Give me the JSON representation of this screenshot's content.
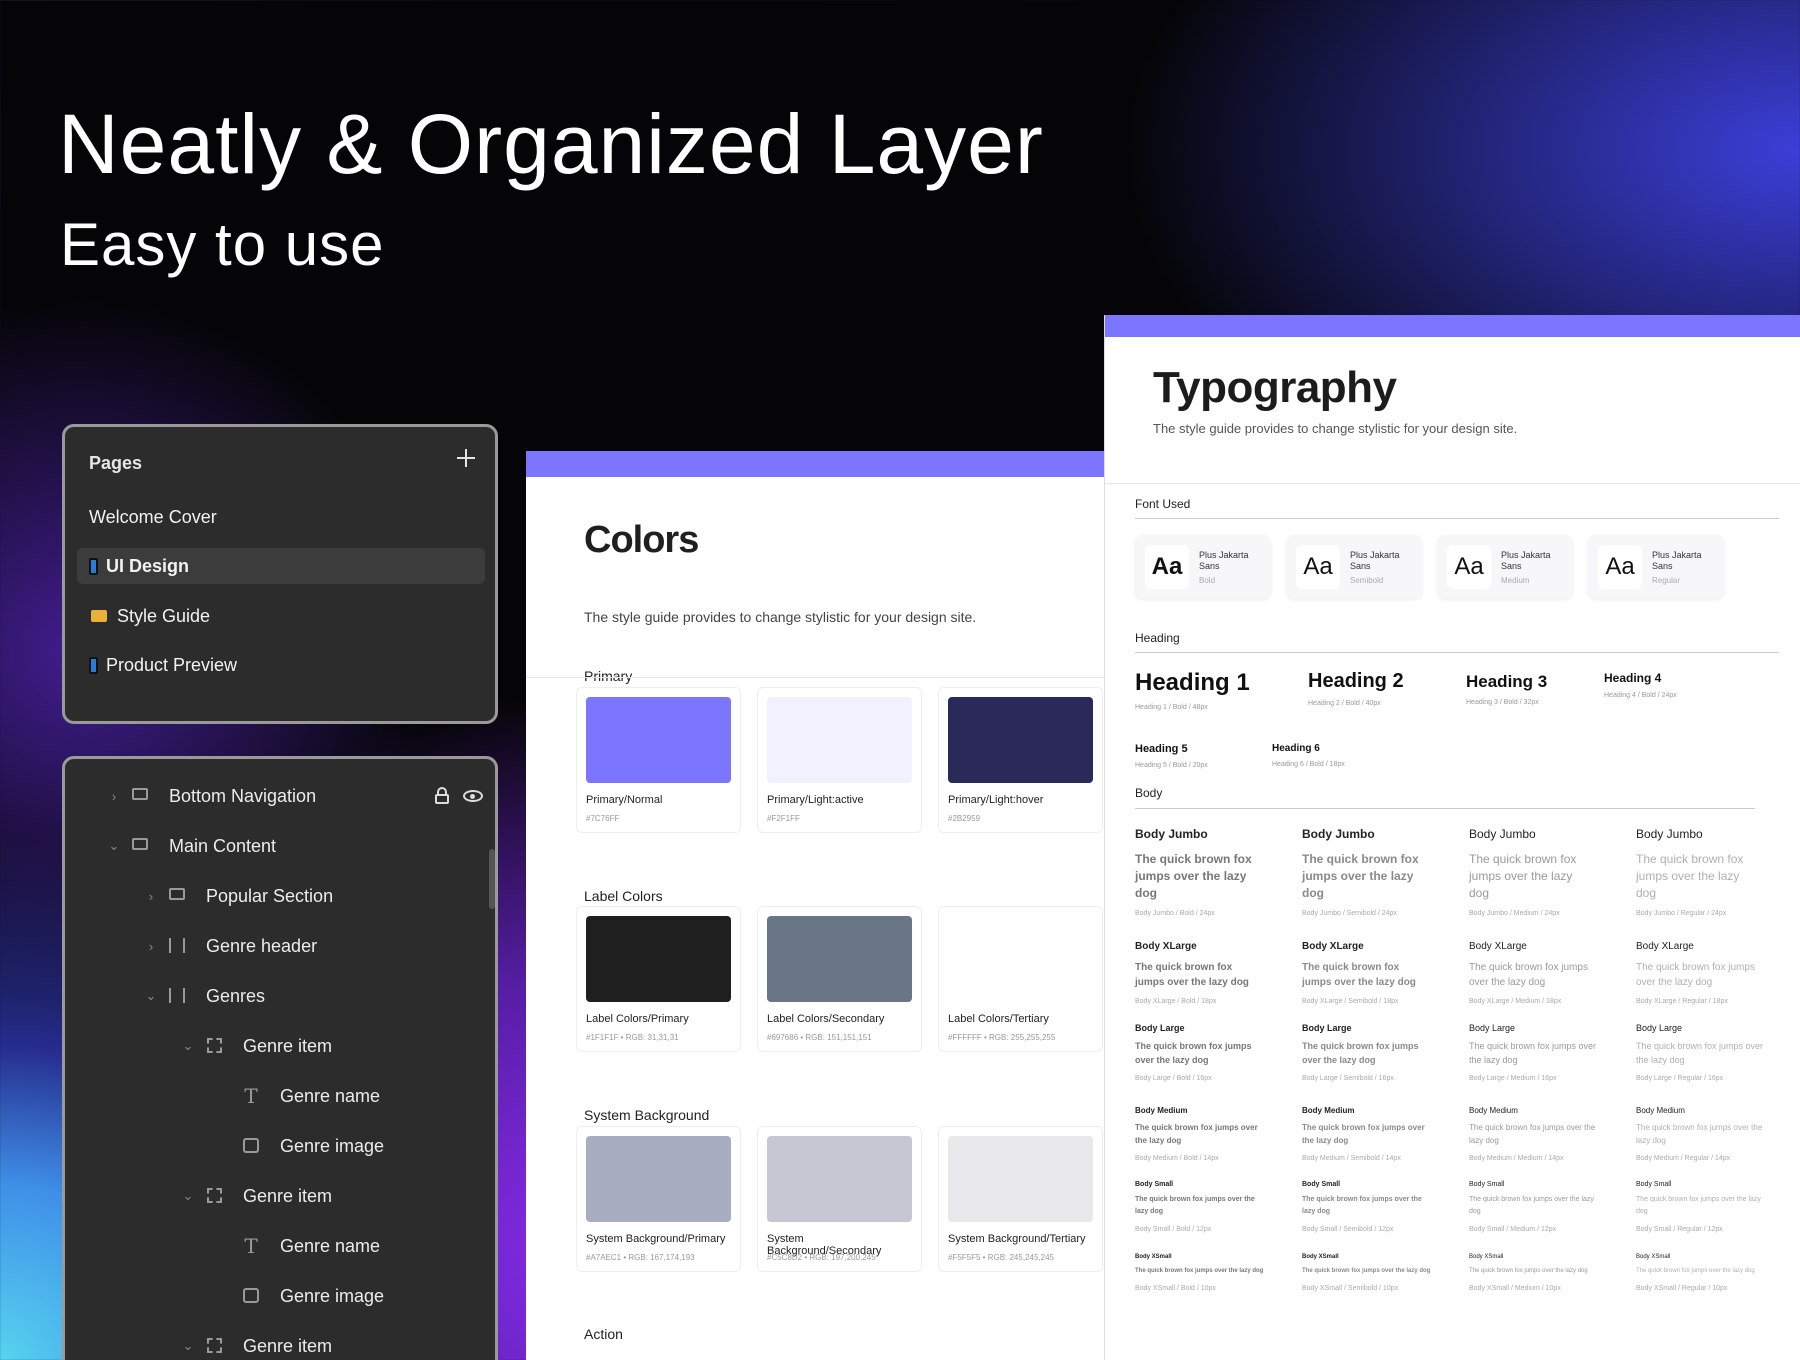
{
  "hero": {
    "title": "Neatly & Organized Layer",
    "subtitle": "Easy to use"
  },
  "pages_panel": {
    "title": "Pages",
    "items": [
      {
        "label": "Welcome Cover",
        "icon": "none"
      },
      {
        "label": "UI Design",
        "icon": "phone-icon"
      },
      {
        "label": "Style Guide",
        "icon": "folder-icon"
      },
      {
        "label": "Product Preview",
        "icon": "phone-icon"
      }
    ]
  },
  "layers_panel": {
    "items": [
      {
        "label": "Bottom Navigation",
        "icon": "frame-icon",
        "expanded": false
      },
      {
        "label": "Main Content",
        "icon": "frame-icon",
        "expanded": true
      },
      {
        "label": "Popular Section",
        "icon": "frame-icon",
        "expanded": false
      },
      {
        "label": "Genre header",
        "icon": "columns-icon",
        "expanded": false
      },
      {
        "label": "Genres",
        "icon": "columns-icon",
        "expanded": true
      },
      {
        "label": "Genre item",
        "icon": "dashed-frame-icon",
        "expanded": true
      },
      {
        "label": "Genre name",
        "icon": "text-icon"
      },
      {
        "label": "Genre image",
        "icon": "image-icon"
      },
      {
        "label": "Genre item",
        "icon": "dashed-frame-icon",
        "expanded": true
      },
      {
        "label": "Genre name",
        "icon": "text-icon"
      },
      {
        "label": "Genre image",
        "icon": "image-icon"
      },
      {
        "label": "Genre item",
        "icon": "dashed-frame-icon",
        "expanded": true
      }
    ]
  },
  "colors_card": {
    "title": "Colors",
    "desc": "The style guide provides to change stylistic for your design site.",
    "sections": [
      {
        "title": "Primary",
        "swatches": [
          {
            "name": "Primary/Normal",
            "hex": "#7C76FF",
            "color": "#7C76FF"
          },
          {
            "name": "Primary/Light:active",
            "hex": "#F2F1FF",
            "color": "#F2F1FF"
          },
          {
            "name": "Primary/Light:hover",
            "hex": "#2B2959",
            "color": "#2B2959"
          }
        ]
      },
      {
        "title": "Label Colors",
        "swatches": [
          {
            "name": "Label Colors/Primary",
            "hex": "#1F1F1F  •  RGB: 31,31,31",
            "color": "#1F1F1F"
          },
          {
            "name": "Label Colors/Secondary",
            "hex": "#697686  •  RGB: 151,151,151",
            "color": "#697686"
          },
          {
            "name": "Label Colors/Tertiary",
            "hex": "#FFFFFF  •  RGB: 255,255,255",
            "color": "#FFFFFF"
          }
        ]
      },
      {
        "title": "System Background",
        "swatches": [
          {
            "name": "System Background/Primary",
            "hex": "#A7AEC1  •  RGB: 167,174,193",
            "color": "#A7AEC1"
          },
          {
            "name": "System Background/Secondary",
            "hex": "#C5C8D2  •  RGB: 197,200,245",
            "color": "#C5C8D2"
          },
          {
            "name": "System Background/Tertiary",
            "hex": "#F5F5F5  •  RGB: 245,245,245",
            "color": "#E8E8EA"
          }
        ]
      },
      {
        "title": "Action",
        "swatches": []
      }
    ]
  },
  "typography_card": {
    "title": "Typography",
    "desc": "The style guide provides to change stylistic for your design site.",
    "font_used_label": "Font Used",
    "fonts": [
      {
        "aa": "Aa",
        "name": "Plus Jakarta Sans",
        "weight": "Bold"
      },
      {
        "aa": "Aa",
        "name": "Plus Jakarta Sans",
        "weight": "Semibold"
      },
      {
        "aa": "Aa",
        "name": "Plus Jakarta Sans",
        "weight": "Medium"
      },
      {
        "aa": "Aa",
        "name": "Plus Jakarta Sans",
        "weight": "Regular"
      }
    ],
    "heading_label": "Heading",
    "headings": [
      {
        "name": "Heading 1",
        "meta": "Heading 1 / Bold / 48px"
      },
      {
        "name": "Heading 2",
        "meta": "Heading 2 / Bold / 40px"
      },
      {
        "name": "Heading 3",
        "meta": "Heading 3 / Bold / 32px"
      },
      {
        "name": "Heading 4",
        "meta": "Heading 4 / Bold / 24px"
      },
      {
        "name": "Heading 5",
        "meta": "Heading 5 / Bold / 20px"
      },
      {
        "name": "Heading 6",
        "meta": "Heading 6 / Bold / 18px"
      }
    ],
    "body_label": "Body",
    "body_rows": [
      {
        "name": "Body Jumbo",
        "sample": "The quick brown fox jumps over the lazy dog",
        "metas": [
          "Body Jumbo / Bold / 24px",
          "Body Jumbo / Semibold / 24px",
          "Body Jumbo / Medium / 24px",
          "Body Jumbo / Regular / 24px"
        ]
      },
      {
        "name": "Body XLarge",
        "sample": "The quick brown fox jumps over the lazy dog",
        "metas": [
          "Body XLarge / Bold / 18px",
          "Body XLarge / Semibold / 18px",
          "Body XLarge / Medium / 18px",
          "Body XLarge / Regular / 18px"
        ]
      },
      {
        "name": "Body Large",
        "sample": "The quick brown fox jumps over the lazy dog",
        "metas": [
          "Body Large / Bold / 16px",
          "Body Large / Semibold / 16px",
          "Body Large / Medium / 16px",
          "Body Large / Regular / 16px"
        ]
      },
      {
        "name": "Body Medium",
        "sample": "The quick brown fox jumps over the lazy dog",
        "metas": [
          "Body Medium / Bold / 14px",
          "Body Medium / Semibold / 14px",
          "Body Medium / Medium / 14px",
          "Body Medium / Regular / 14px"
        ]
      },
      {
        "name": "Body Small",
        "sample": "The quick brown fox jumps over the lazy dog",
        "metas": [
          "Body Small / Bold / 12px",
          "Body Small / Semibold / 12px",
          "Body Small / Medium / 12px",
          "Body Small / Regular / 12px"
        ]
      },
      {
        "name": "Body XSmall",
        "sample": "The quick brown fox jumps over the lazy dog",
        "metas": [
          "Body XSmall / Bold / 10px",
          "Body XSmall / Semibold / 10px",
          "Body XSmall / Medium / 10px",
          "Body XSmall / Regular / 10px"
        ]
      }
    ]
  }
}
